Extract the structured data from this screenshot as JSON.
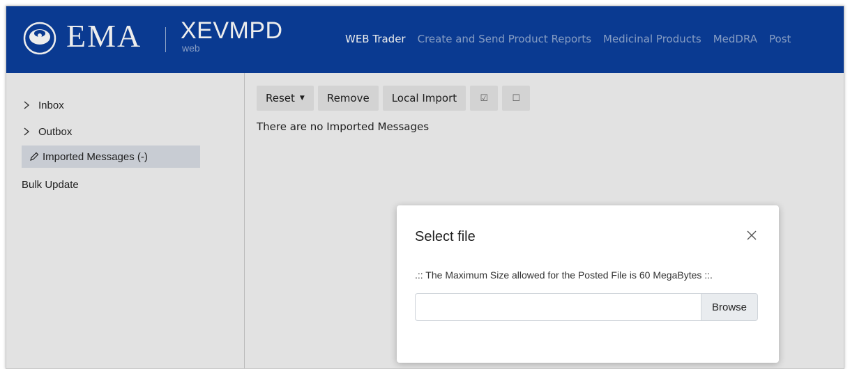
{
  "header": {
    "logo_text": "EMA",
    "app_name": "XEVMPD",
    "app_sub": "web",
    "nav": [
      {
        "label": "WEB Trader"
      },
      {
        "label": "Create and Send Product Reports"
      },
      {
        "label": "Medicinal Products"
      },
      {
        "label": "MedDRA"
      },
      {
        "label": "Post"
      }
    ],
    "colors": {
      "header_bg": "#0b3f9c"
    }
  },
  "sidebar": {
    "items": [
      {
        "label": "Inbox",
        "icon": "chevron-right-icon"
      },
      {
        "label": "Outbox",
        "icon": "chevron-right-icon"
      },
      {
        "label": "Imported Messages (-)",
        "icon": "pencil-icon"
      },
      {
        "label": "Bulk Update"
      }
    ]
  },
  "toolbar": {
    "reset_label": "Reset",
    "remove_label": "Remove",
    "local_import_label": "Local Import",
    "check_all_glyph": "☑",
    "uncheck_all_glyph": "☐"
  },
  "main": {
    "empty_message": "There are no Imported Messages"
  },
  "modal": {
    "title": "Select file",
    "info": ".:: The Maximum Size allowed for the Posted File is 60 MegaBytes ::.",
    "file_value": "",
    "browse_label": "Browse"
  }
}
